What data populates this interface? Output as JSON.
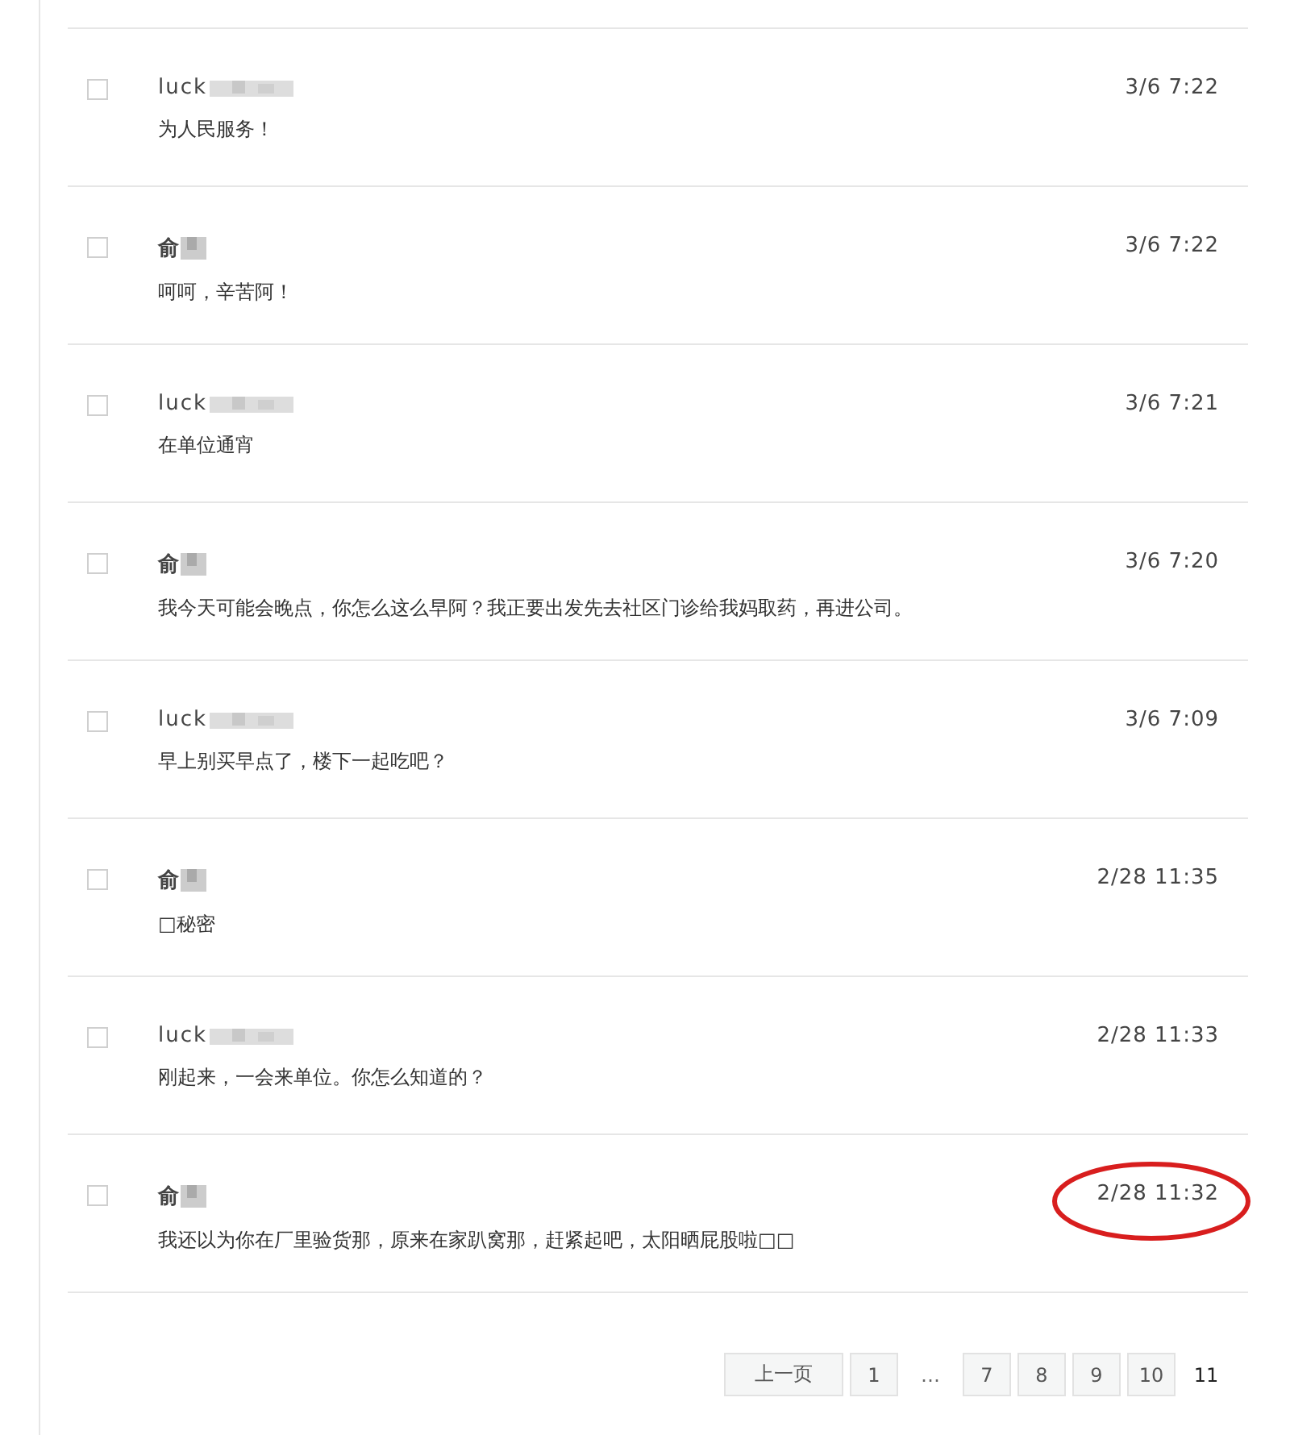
{
  "messages": [
    {
      "sender": "luck",
      "kind": "plain",
      "redacted": true,
      "checked": false,
      "time": "3/6 7:22",
      "text": "为人民服务！",
      "highlighted": false
    },
    {
      "sender": "俞",
      "kind": "bold",
      "redacted": true,
      "checked": false,
      "time": "3/6 7:22",
      "text": "呵呵，辛苦阿！",
      "highlighted": false
    },
    {
      "sender": "luck",
      "kind": "plain",
      "redacted": true,
      "checked": false,
      "time": "3/6 7:21",
      "text": "在单位通宵",
      "highlighted": false
    },
    {
      "sender": "俞",
      "kind": "bold",
      "redacted": true,
      "checked": false,
      "time": "3/6 7:20",
      "text": "我今天可能会晚点，你怎么这么早阿？我正要出发先去社区门诊给我妈取药，再进公司。",
      "highlighted": false
    },
    {
      "sender": "luck",
      "kind": "plain",
      "redacted": true,
      "checked": false,
      "time": "3/6 7:09",
      "text": "早上别买早点了，楼下一起吃吧？",
      "highlighted": false
    },
    {
      "sender": "俞",
      "kind": "bold",
      "redacted": true,
      "checked": false,
      "time": "2/28 11:35",
      "text": "□秘密",
      "highlighted": false
    },
    {
      "sender": "luck",
      "kind": "plain",
      "redacted": true,
      "checked": false,
      "time": "2/28 11:33",
      "text": "刚起来，一会来单位。你怎么知道的？",
      "highlighted": false
    },
    {
      "sender": "俞",
      "kind": "bold",
      "redacted": true,
      "checked": false,
      "time": "2/28 11:32",
      "text": "我还以为你在厂里验货那，原来在家趴窝那，赶紧起吧，太阳晒屁股啦□□",
      "highlighted": true
    }
  ],
  "pagination": [
    {
      "kind": "button",
      "label": "上一页",
      "selected": false
    },
    {
      "kind": "button",
      "label": "1",
      "selected": false
    },
    {
      "kind": "ellipsis",
      "label": "…"
    },
    {
      "kind": "button",
      "label": "7",
      "selected": false
    },
    {
      "kind": "button",
      "label": "8",
      "selected": false
    },
    {
      "kind": "button",
      "label": "9",
      "selected": false
    },
    {
      "kind": "button",
      "label": "10",
      "selected": false
    },
    {
      "kind": "button",
      "label": "11",
      "selected": true
    }
  ]
}
